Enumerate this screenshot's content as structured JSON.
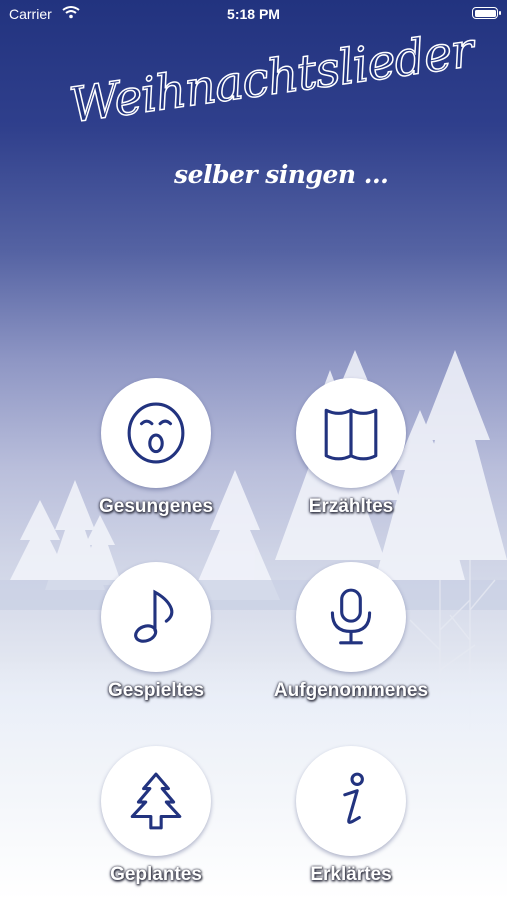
{
  "status_bar": {
    "carrier": "Carrier",
    "time": "5:18 PM"
  },
  "header": {
    "title": "Weihnachtslieder",
    "subtitle": "selber singen ..."
  },
  "colors": {
    "accent": "#22337f",
    "label": "#ffffff"
  },
  "menu": [
    {
      "label": "Gesungenes",
      "icon": "singing-face-icon"
    },
    {
      "label": "Erzähltes",
      "icon": "book-icon"
    },
    {
      "label": "Gespieltes",
      "icon": "music-note-icon"
    },
    {
      "label": "Aufgenommenes",
      "icon": "microphone-icon"
    },
    {
      "label": "Geplantes",
      "icon": "fir-tree-icon"
    },
    {
      "label": "Erklärtes",
      "icon": "info-icon"
    }
  ]
}
